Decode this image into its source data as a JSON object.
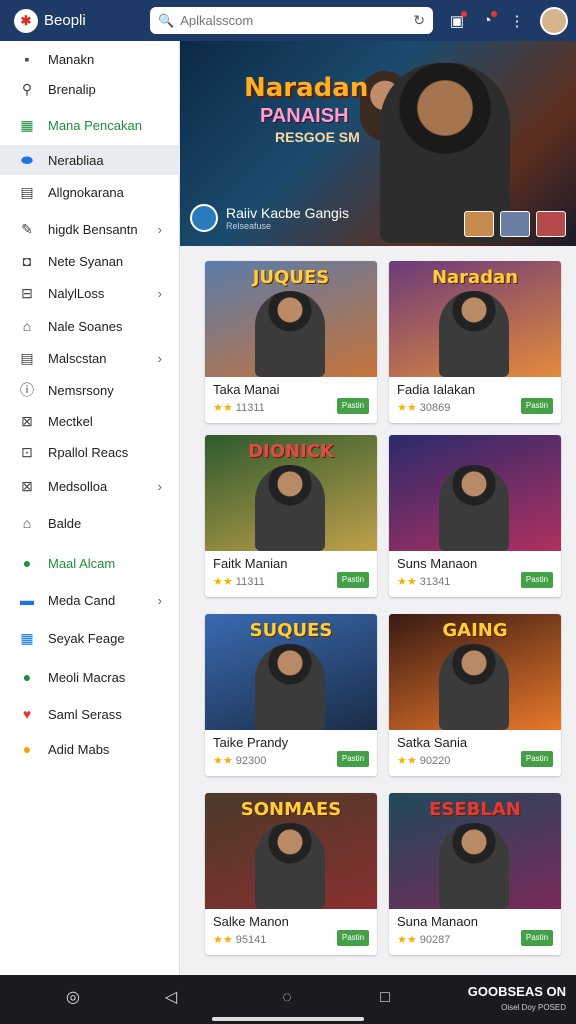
{
  "header": {
    "brand": "Beopli",
    "search_placeholder": "Aplkalsscom",
    "icons": [
      "notifications-icon",
      "alerts-icon",
      "more-icon"
    ]
  },
  "sidebar": {
    "items": [
      {
        "label": "Manakn",
        "icon": "square-icon"
      },
      {
        "label": "Brenalip",
        "icon": "search-icon"
      },
      {
        "label": "Mana Pencakan",
        "icon": "gift-icon"
      },
      {
        "label": "Nerabliaa",
        "icon": "oval-icon"
      },
      {
        "label": "Allgnokarana",
        "icon": "grid-icon"
      },
      {
        "label": "higdk Bensantn",
        "icon": "pen-icon"
      },
      {
        "label": "Nete Syanan",
        "icon": "camera-icon"
      },
      {
        "label": "NalylLoss",
        "icon": "box-icon"
      },
      {
        "label": "Nale Soanes",
        "icon": "home-icon"
      },
      {
        "label": "Malscstan",
        "icon": "grid-icon"
      },
      {
        "label": "Nemsrsony",
        "icon": "info-icon"
      },
      {
        "label": "Mectkel",
        "icon": "square-icon"
      },
      {
        "label": "Rpallol Reacs",
        "icon": "square-icon"
      },
      {
        "label": "Medsolloa",
        "icon": "square-icon"
      },
      {
        "label": "Balde",
        "icon": "home-icon"
      },
      {
        "label": "Maal Alcam",
        "icon": "chat-icon"
      },
      {
        "label": "Meda Cand",
        "icon": "card-icon"
      },
      {
        "label": "Seyak Feage",
        "icon": "grid-icon"
      },
      {
        "label": "Meoli Macras",
        "icon": "compass-icon"
      },
      {
        "label": "Saml Serass",
        "icon": "heart-icon"
      },
      {
        "label": "Adid Mabs",
        "icon": "circle-icon"
      }
    ]
  },
  "hero": {
    "title": "Naradan",
    "subtitle": "PANAISH",
    "tagline": "RESGOE SM",
    "app_name": "Raiiv Kacbe Gangis",
    "app_sub": "Relseafuse"
  },
  "cards": [
    {
      "art_title": "JUQUES",
      "name": "Taka Manai",
      "rating": "11311",
      "price": "Pastin"
    },
    {
      "art_title": "Naradan",
      "name": "Fadia Ialakan",
      "rating": "30869",
      "price": "Pastin"
    },
    {
      "art_title": "DIONICK",
      "name": "Faitk Manian",
      "rating": "11311",
      "price": "Pastin"
    },
    {
      "art_title": "",
      "name": "Suns Manaon",
      "rating": "31341",
      "price": "Pastin"
    },
    {
      "art_title": "SUQUES",
      "name": "Taike Prandy",
      "rating": "92300",
      "price": "Pastin"
    },
    {
      "art_title": "GAING",
      "name": "Satka Sania",
      "rating": "90220",
      "price": "Pastin"
    },
    {
      "art_title": "SONMAES",
      "name": "Salke Manon",
      "rating": "95141",
      "price": "Pastin"
    },
    {
      "art_title": "ESEBLAN",
      "name": "Suna Manaon",
      "rating": "90287",
      "price": "Pastin"
    }
  ],
  "footer": {
    "brand": "GOOBSEAS ON",
    "sub": "Oisel Doy POSED"
  }
}
